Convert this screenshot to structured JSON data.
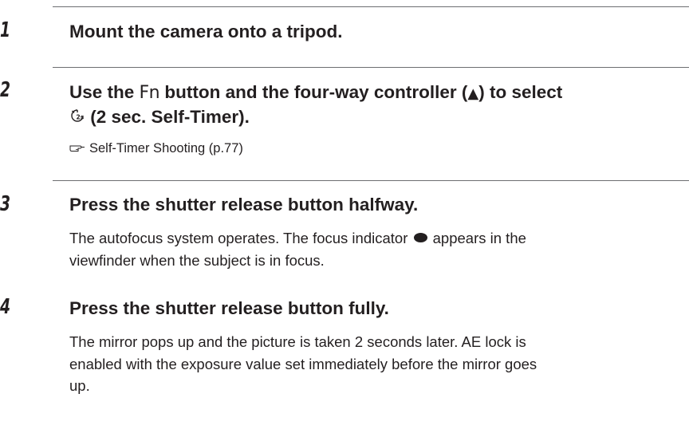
{
  "steps": [
    {
      "number": "1",
      "title": "Mount the camera onto a tripod."
    },
    {
      "number": "2",
      "title_part1": "Use the ",
      "title_fn": "Fn",
      "title_part2": " button and the four-way controller (",
      "title_arrow": "▲",
      "title_part3": ") to select",
      "title_line2": " (2 sec. Self-Timer).",
      "timer_icon": "2-sec-self-timer-icon",
      "reference": "Self-Timer Shooting (p.77)",
      "reference_icon": "pointing-hand-icon"
    },
    {
      "number": "3",
      "title": "Press the shutter release button halfway.",
      "body_part1": "The autofocus system operates. The focus indicator ",
      "focus_icon": "focus-indicator-icon",
      "body_part2": " appears in the",
      "body_line2": "viewfinder when the subject is in focus."
    },
    {
      "number": "4",
      "title": "Press the shutter release button fully.",
      "body_line1": "The mirror pops up and the picture is taken 2 seconds later. AE lock is",
      "body_line2": "enabled with the exposure value set immediately before the mirror goes",
      "body_line3": "up."
    }
  ]
}
